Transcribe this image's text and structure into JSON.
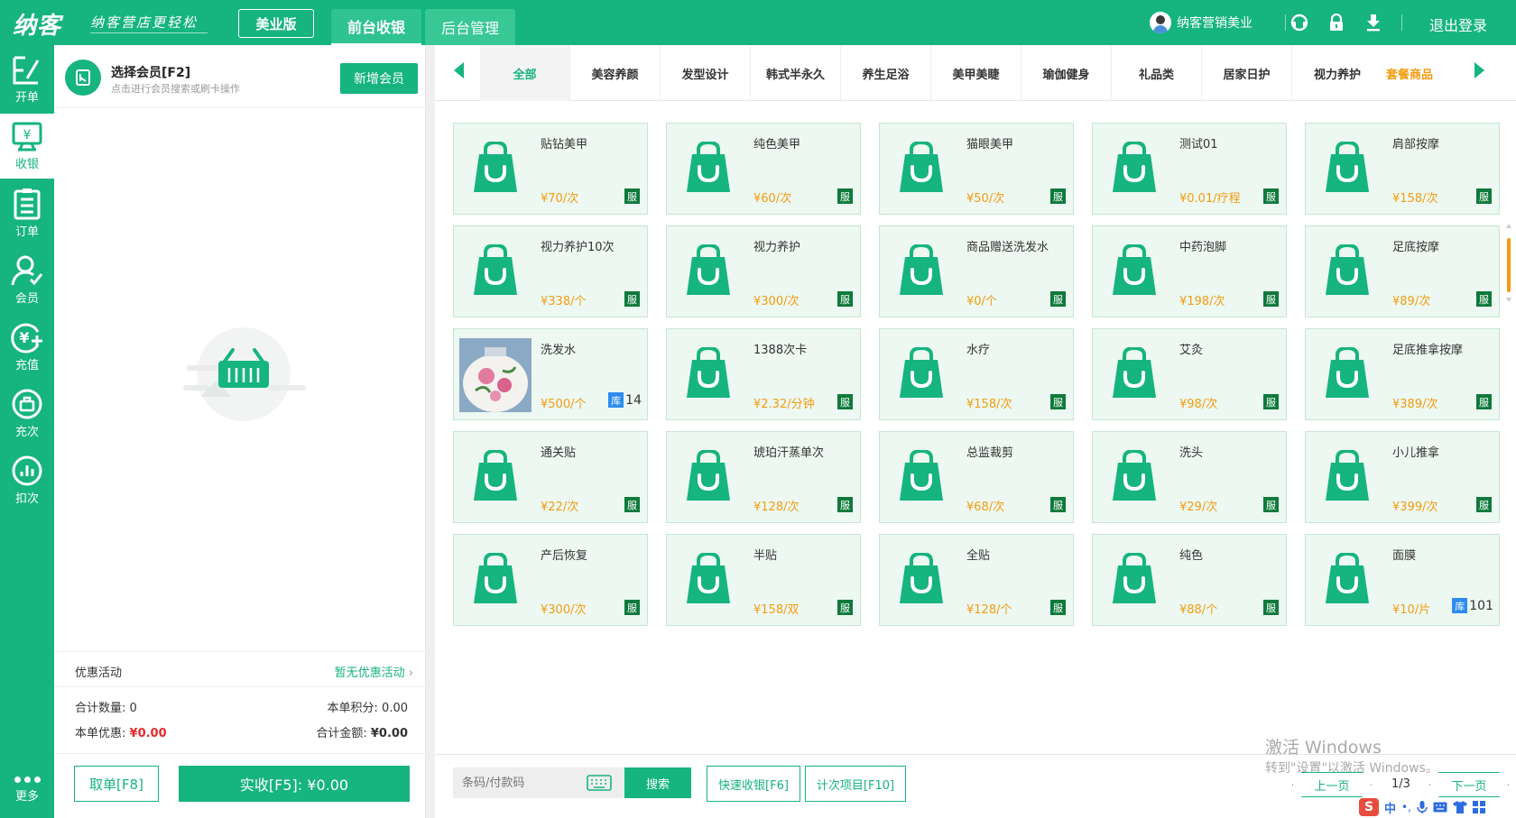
{
  "header": {
    "logo": "纳客",
    "slogan": "纳客营店更轻松",
    "edition": "美业版",
    "tabs": [
      {
        "label": "前台收银",
        "active": true
      },
      {
        "label": "后台管理",
        "active": false
      }
    ],
    "user_name": "纳客营销美业",
    "logout": "退出登录",
    "icons": [
      "headset-icon",
      "lock-icon",
      "download-icon"
    ]
  },
  "sidebar": {
    "items": [
      {
        "label": "开单",
        "icon": "edit-icon",
        "active": false
      },
      {
        "label": "收银",
        "icon": "cashier-icon",
        "active": true
      },
      {
        "label": "订单",
        "icon": "order-list-icon",
        "active": false
      },
      {
        "label": "会员",
        "icon": "member-icon",
        "active": false
      },
      {
        "label": "充值",
        "icon": "recharge-icon",
        "active": false
      },
      {
        "label": "充次",
        "icon": "recharge-times-icon",
        "active": false
      },
      {
        "label": "扣次",
        "icon": "deduct-times-icon",
        "active": false
      }
    ],
    "more": "更多"
  },
  "left_panel": {
    "member_title": "选择会员[F2]",
    "member_sub": "点击进行会员搜索或刷卡操作",
    "add_member": "新增会员",
    "promo_label": "优惠活动",
    "promo_value": "暂无优惠活动",
    "total_qty_label": "合计数量:",
    "total_qty_value": "0",
    "points_label": "本单积分:",
    "points_value": "0.00",
    "discount_label": "本单优惠:",
    "discount_value": "¥0.00",
    "total_amount_label": "合计金额:",
    "total_amount_value": "¥0.00",
    "cancel_btn": "取单[F8]",
    "pay_btn": "实收[F5]: ¥0.00"
  },
  "categories": [
    "全部",
    "美容养颜",
    "发型设计",
    "韩式半永久",
    "养生足浴",
    "美甲美睫",
    "瑜伽健身",
    "礼品类",
    "居家日护",
    "视力养护",
    "套餐商品"
  ],
  "products": [
    {
      "name": "贴钻美甲",
      "price": "¥70/次",
      "tag": "服"
    },
    {
      "name": "纯色美甲",
      "price": "¥60/次",
      "tag": "服"
    },
    {
      "name": "猫眼美甲",
      "price": "¥50/次",
      "tag": "服"
    },
    {
      "name": "测试01",
      "price": "¥0.01/疗程",
      "tag": "服"
    },
    {
      "name": "肩部按摩",
      "price": "¥158/次",
      "tag": "服"
    },
    {
      "name": "视力养护10次",
      "price": "¥338/个",
      "tag": "服"
    },
    {
      "name": "视力养护",
      "price": "¥300/次",
      "tag": "服"
    },
    {
      "name": "商品赠送洗发水",
      "price": "¥0/个",
      "tag": "服"
    },
    {
      "name": "中药泡脚",
      "price": "¥198/次",
      "tag": "服"
    },
    {
      "name": "足底按摩",
      "price": "¥89/次",
      "tag": "服"
    },
    {
      "name": "洗发水",
      "price": "¥500/个",
      "stock_label": "库",
      "stock": "14",
      "photo": true
    },
    {
      "name": "1388次卡",
      "price": "¥2.32/分钟",
      "tag": "服"
    },
    {
      "name": "水疗",
      "price": "¥158/次",
      "tag": "服"
    },
    {
      "name": "艾灸",
      "price": "¥98/次",
      "tag": "服"
    },
    {
      "name": "足底推拿按摩",
      "price": "¥389/次",
      "tag": "服"
    },
    {
      "name": "通关贴",
      "price": "¥22/次",
      "tag": "服"
    },
    {
      "name": "琥珀汗蒸单次",
      "price": "¥128/次",
      "tag": "服"
    },
    {
      "name": "总监裁剪",
      "price": "¥68/次",
      "tag": "服"
    },
    {
      "name": "洗头",
      "price": "¥29/次",
      "tag": "服"
    },
    {
      "name": "小儿推拿",
      "price": "¥399/次",
      "tag": "服"
    },
    {
      "name": "产后恢复",
      "price": "¥300/次",
      "tag": "服"
    },
    {
      "name": "半贴",
      "price": "¥158/双",
      "tag": "服"
    },
    {
      "name": "全贴",
      "price": "¥128/个",
      "tag": "服"
    },
    {
      "name": "纯色",
      "price": "¥88/个",
      "tag": "服"
    },
    {
      "name": "面膜",
      "price": "¥10/片",
      "stock_label": "库",
      "stock": "101"
    }
  ],
  "bottom": {
    "barcode_placeholder": "条码/付款码",
    "search": "搜索",
    "quick_cash": "快速收银[F6]",
    "count_items": "计次项目[F10]",
    "prev": "上一页",
    "page": "1/3",
    "next": "下一页",
    "watermark_title": "激活 Windows",
    "watermark_sub": "转到\"设置\"以激活 Windows。",
    "ime_s": "S",
    "ime_zh": "中",
    "ime_punct": "•,"
  },
  "colors": {
    "brand": "#16b47e",
    "price": "#f39c12",
    "red": "#e52b2b",
    "service_tag": "#0e7a3b",
    "stock_tag": "#2d8cf0"
  }
}
